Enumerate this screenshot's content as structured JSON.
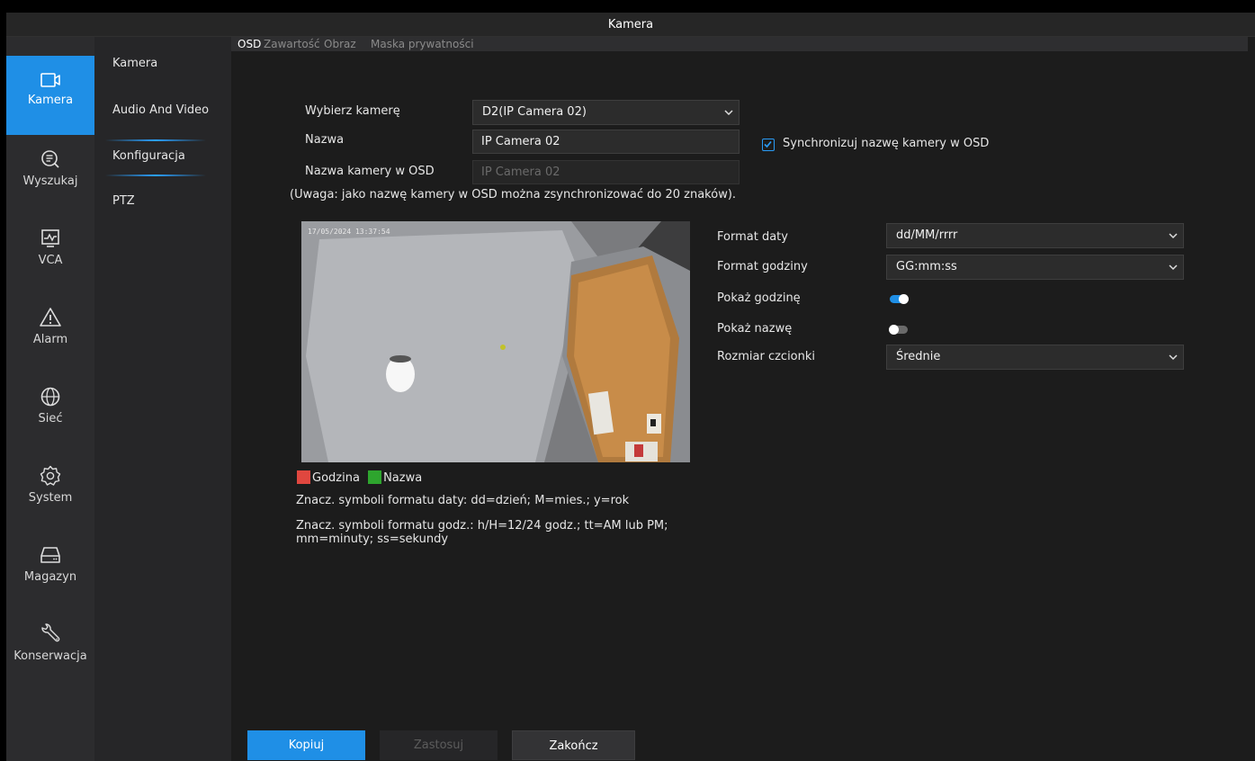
{
  "window": {
    "title": "Kamera"
  },
  "rail": [
    {
      "label": "Kamera",
      "icon": "camera-icon",
      "active": true
    },
    {
      "label": "Wyszukaj",
      "icon": "search-icon"
    },
    {
      "label": "VCA",
      "icon": "vca-icon"
    },
    {
      "label": "Alarm",
      "icon": "alarm-icon"
    },
    {
      "label": "Sieć",
      "icon": "network-icon"
    },
    {
      "label": "System",
      "icon": "gear-icon"
    },
    {
      "label": "Magazyn",
      "icon": "storage-icon"
    },
    {
      "label": "Konserwacja",
      "icon": "wrench-icon"
    }
  ],
  "submenu": [
    {
      "label": "Kamera"
    },
    {
      "label": "Audio And Video"
    },
    {
      "label": "Konfiguracja",
      "active": true
    },
    {
      "label": "PTZ"
    }
  ],
  "tabs": [
    {
      "label": "OSD",
      "active": true
    },
    {
      "label": "Zawartość"
    },
    {
      "label": "Obraz"
    },
    {
      "label": "Maska prywatności"
    }
  ],
  "form": {
    "camera_label": "Wybierz kamerę",
    "camera_value": "D2(IP Camera 02)",
    "name_label": "Nazwa",
    "name_value": "IP Camera 02",
    "osd_name_label": "Nazwa kamery w OSD",
    "osd_name_value": "IP Camera 02",
    "sync_label": "Synchronizuj nazwę kamery w OSD",
    "sync_checked": true,
    "note": "(Uwaga: jako nazwę kamery w OSD można zsynchronizować do 20 znaków)."
  },
  "preview": {
    "timestamp": "17/05/2024 13:37:54",
    "legend_time": "Godzina",
    "legend_name": "Nazwa",
    "time_color": "#e0473f",
    "name_color": "#2ea52e",
    "date_hint": "Znacz. symboli formatu daty: dd=dzień; M=mies.; y=rok",
    "time_hint_1": "Znacz. symboli formatu godz.: h/H=12/24 godz.; tt=AM lub PM;",
    "time_hint_2": "mm=minuty; ss=sekundy"
  },
  "settings": {
    "date_format_label": "Format daty",
    "date_format_value": "dd/MM/rrrr",
    "time_format_label": "Format godziny",
    "time_format_value": "GG:mm:ss",
    "show_time_label": "Pokaż godzinę",
    "show_time_on": true,
    "show_name_label": "Pokaż nazwę",
    "show_name_on": false,
    "font_size_label": "Rozmiar czcionki",
    "font_size_value": "Średnie"
  },
  "buttons": {
    "copy": "Kopiuj",
    "apply": "Zastosuj",
    "exit": "Zakończ"
  },
  "colors": {
    "accent": "#1f8fe6",
    "background": "#1c1c1c",
    "rail": "#2c2c2e"
  }
}
